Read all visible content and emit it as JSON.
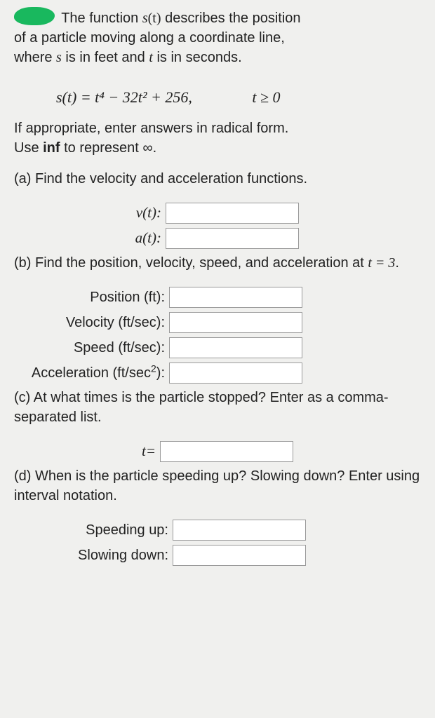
{
  "intro": {
    "line1_after_badge": "The function ",
    "func": "s",
    "t_arg": "(t)",
    "line1_rest": " describes the position",
    "line2": "of a particle moving along a coordinate line,",
    "line3_pre": "where ",
    "s_var": "s",
    "line3_mid": " is in feet and ",
    "t_var": "t",
    "line3_end": " is in seconds."
  },
  "equation": {
    "expr": "s(t) = t⁴ − 32t² + 256,",
    "cond": "t ≥ 0"
  },
  "note": {
    "line1": "If appropriate, enter answers in radical form.",
    "line2_pre": "Use ",
    "inf": "inf",
    "line2_post": " to represent ∞."
  },
  "parts": {
    "a": {
      "prompt": "(a) Find the velocity and acceleration functions.",
      "v_label": "v(t):",
      "a_label": "a(t):"
    },
    "b": {
      "prompt_pre": "(b) Find the position, velocity, speed, and acceleration at ",
      "prompt_t": "t = 3",
      "prompt_post": ".",
      "position_label": "Position (ft):",
      "velocity_label": "Velocity (ft/sec):",
      "speed_label": "Speed (ft/sec):",
      "accel_label_pre": "Acceleration (ft/sec",
      "accel_label_post": "):"
    },
    "c": {
      "prompt": "(c) At what times is the particle stopped? Enter as a comma-separated list.",
      "t_label": "t="
    },
    "d": {
      "prompt": "(d) When is the particle speeding up? Slowing down? Enter using interval notation.",
      "speeding_label": "Speeding up:",
      "slowing_label": "Slowing down:"
    }
  }
}
